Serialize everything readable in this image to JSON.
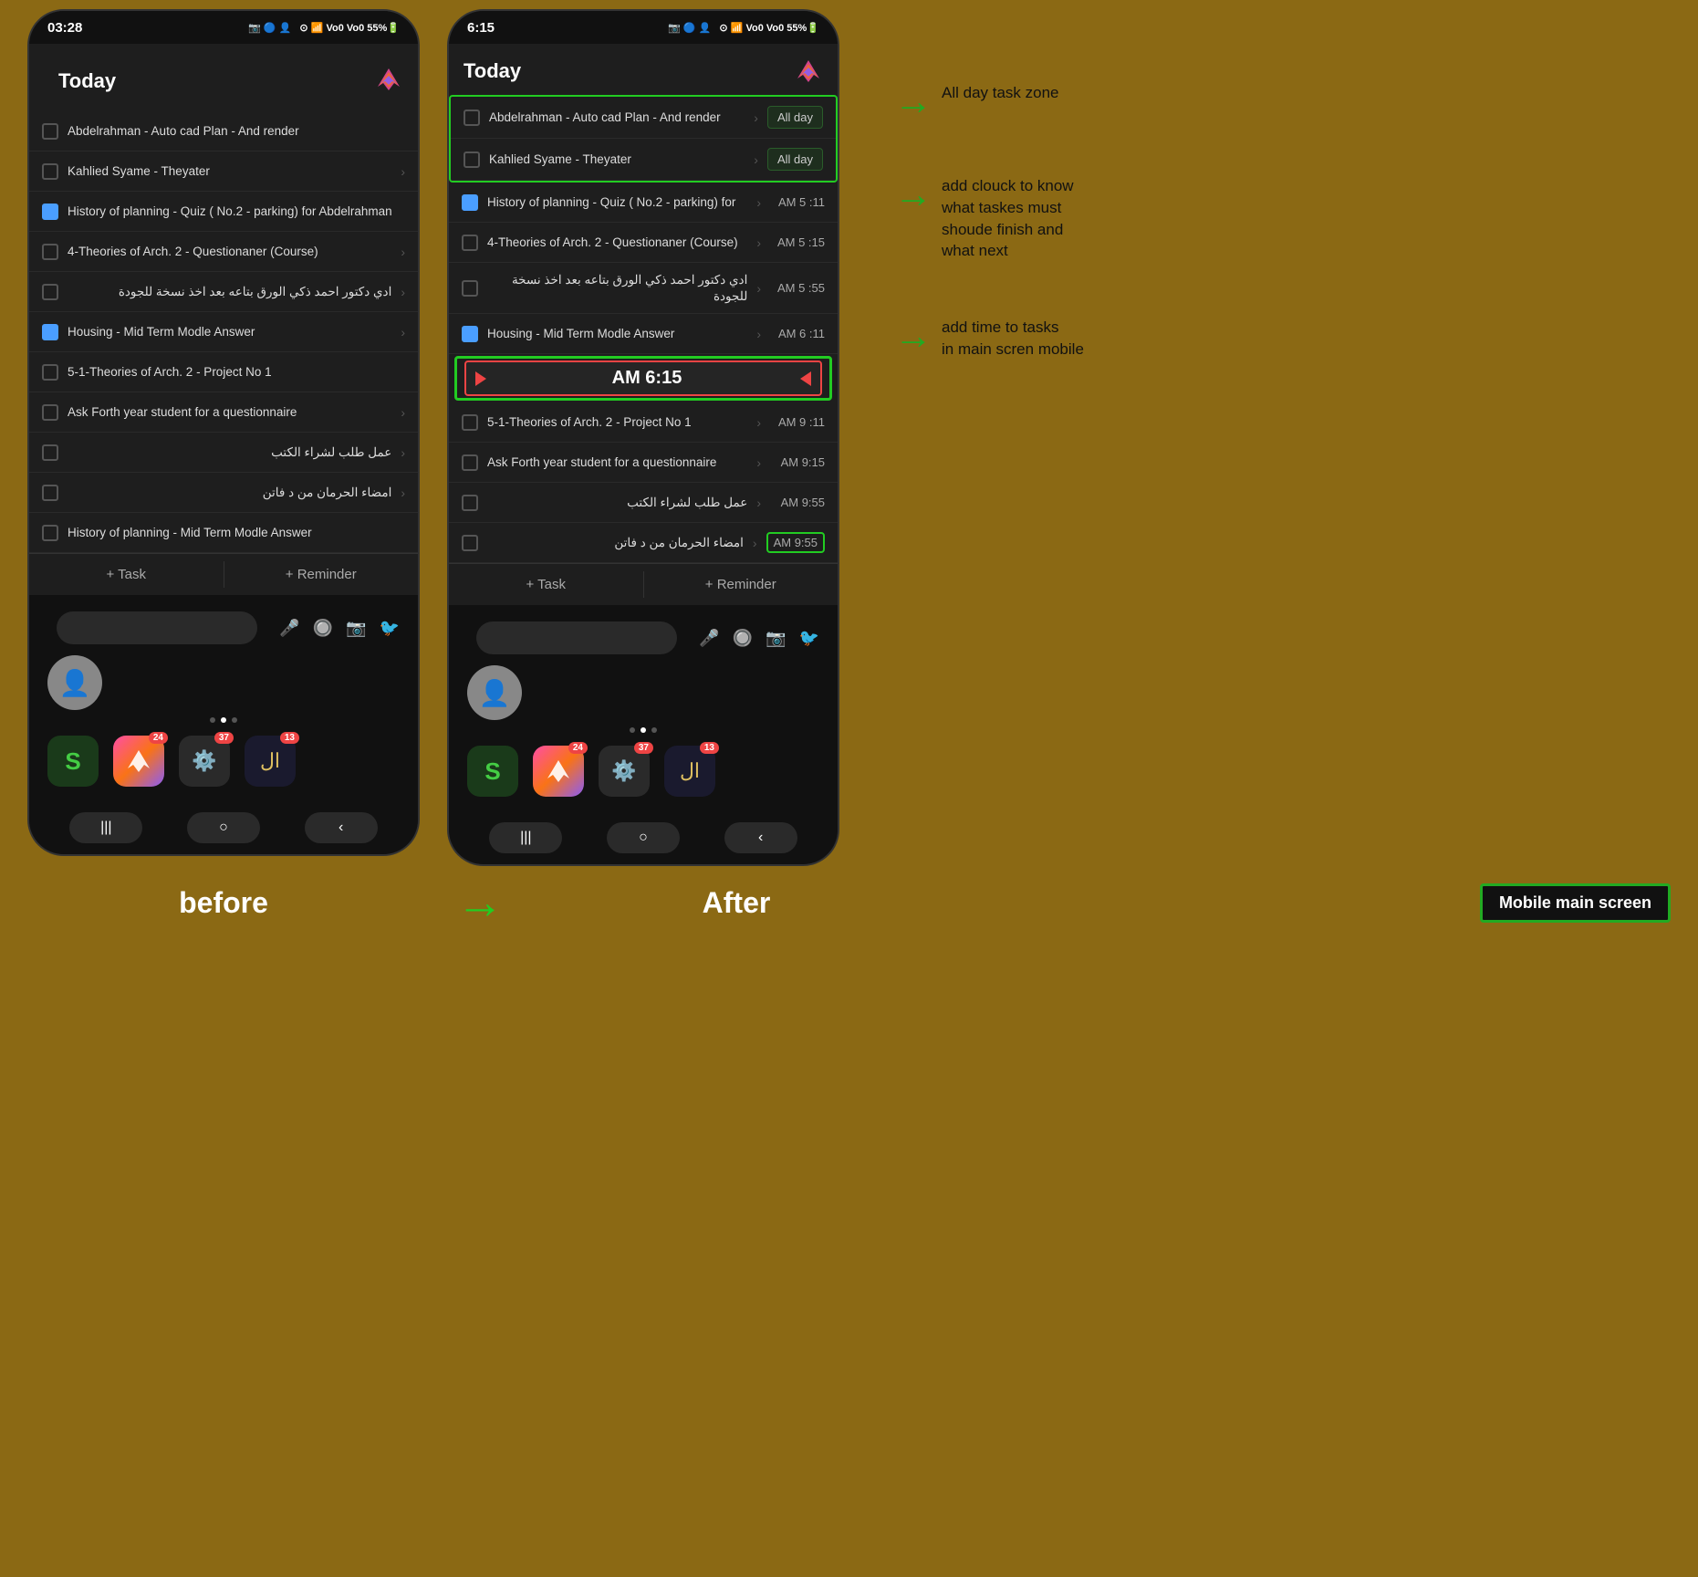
{
  "left_phone": {
    "status_time": "03:28",
    "header_title": "Today",
    "tasks": [
      {
        "id": 1,
        "text": "Abdelrahman - Auto cad Plan - And render",
        "checkbox": "empty",
        "arrow": true,
        "time": ""
      },
      {
        "id": 2,
        "text": "Kahlied Syame - Theyater",
        "checkbox": "empty",
        "arrow": true,
        "time": ""
      },
      {
        "id": 3,
        "text": "History of planning - Quiz ( No.2 - parking)  for Abdelrahman",
        "checkbox": "blue",
        "arrow": false,
        "time": ""
      },
      {
        "id": 4,
        "text": "4-Theories of Arch. 2 - Questionaner (Course)",
        "checkbox": "empty",
        "arrow": true,
        "time": ""
      },
      {
        "id": 5,
        "text": "ادي دكتور احمد ذكي الورق بتاعه بعد اخذ نسخة للجودة",
        "checkbox": "empty",
        "arrow": true,
        "time": "",
        "rtl": true
      },
      {
        "id": 6,
        "text": "Housing - Mid Term Modle Answer",
        "checkbox": "blue",
        "arrow": true,
        "time": ""
      },
      {
        "id": 7,
        "text": "5-1-Theories of Arch. 2 - Project No 1",
        "checkbox": "empty",
        "arrow": false,
        "time": ""
      },
      {
        "id": 8,
        "text": "Ask Forth year student for a questionnaire",
        "checkbox": "empty",
        "arrow": true,
        "time": ""
      },
      {
        "id": 9,
        "text": "عمل طلب لشراء الكتب",
        "checkbox": "empty",
        "arrow": true,
        "time": "",
        "rtl": true
      },
      {
        "id": 10,
        "text": "امضاء الحرمان من د فاتن",
        "checkbox": "empty",
        "arrow": true,
        "time": "",
        "rtl": true
      },
      {
        "id": 11,
        "text": "History of planning - Mid Term Modle Answer",
        "checkbox": "empty",
        "arrow": false,
        "time": ""
      }
    ],
    "bottom_task": "+ Task",
    "bottom_reminder": "+ Reminder"
  },
  "right_phone": {
    "status_time": "6:15",
    "header_title": "Today",
    "tasks": [
      {
        "id": 1,
        "text": "Abdelrahman - Auto cad Plan - And render",
        "checkbox": "empty",
        "arrow": true,
        "time": "All day",
        "allday": true
      },
      {
        "id": 2,
        "text": "Kahlied Syame - Theyater",
        "checkbox": "empty",
        "arrow": true,
        "time": "All day",
        "allday": true
      },
      {
        "id": 3,
        "text": "History of planning - Quiz ( No.2 - parking)  for",
        "checkbox": "blue",
        "arrow": true,
        "time": "AM 5 :11"
      },
      {
        "id": 4,
        "text": "4-Theories of Arch. 2 - Questionaner (Course)",
        "checkbox": "empty",
        "arrow": true,
        "time": "AM 5 :15"
      },
      {
        "id": 5,
        "text": "ادي دكتور احمد ذكي الورق بتاعه بعد اخذ نسخة للجودة",
        "checkbox": "empty",
        "arrow": true,
        "time": "AM 5 :55",
        "rtl": true
      },
      {
        "id": 6,
        "text": "Housing - Mid Term Modle Answer",
        "checkbox": "blue",
        "arrow": true,
        "time": "AM 6 :11"
      },
      {
        "id": 7,
        "text": "current_time",
        "time": "AM 6:15"
      },
      {
        "id": 8,
        "text": "5-1-Theories of Arch. 2 - Project No 1",
        "checkbox": "empty",
        "arrow": true,
        "time": "AM 9 :11"
      },
      {
        "id": 9,
        "text": "Ask Forth year student for a questionnaire",
        "checkbox": "empty",
        "arrow": true,
        "time": "AM 9:15"
      },
      {
        "id": 10,
        "text": "عمل طلب لشراء الكتب",
        "checkbox": "empty",
        "arrow": true,
        "time": "AM 9:55",
        "rtl": true
      },
      {
        "id": 11,
        "text": "امضاء الحرمان من د فاتن",
        "checkbox": "empty",
        "arrow": true,
        "time": "AM 9:55",
        "rtl": true,
        "highlight": true
      }
    ],
    "bottom_task": "+ Task",
    "bottom_reminder": "+ Reminder"
  },
  "annotations": {
    "allday_label": "All day task zone",
    "clock_label": "add clouck to know\nwhat taskes must\nshoude finish and\nwhat next",
    "time_label": "add time to tasks\nin main scren mobile"
  },
  "footer": {
    "before": "before",
    "after": "After",
    "mobile_label": "Mobile main screen"
  },
  "nav": {
    "recent": "|||",
    "home": "○",
    "back": "‹"
  }
}
